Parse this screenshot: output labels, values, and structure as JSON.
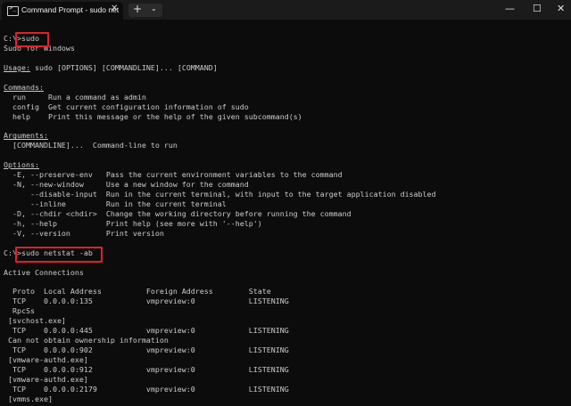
{
  "window": {
    "tab_title": "Command Prompt - sudo  net",
    "tab_icon_glyph": ">_",
    "close_glyph": "✕",
    "new_tab_glyph": "+",
    "dropdown_glyph": "⌄",
    "minimize_glyph": "—",
    "maximize_glyph": "☐",
    "window_close_glyph": "✕"
  },
  "terminal": {
    "lines": [
      "C:\\>sudo",
      "Sudo for Windows",
      "",
      "Usage: sudo [OPTIONS] [COMMANDLINE]... [COMMAND]",
      "",
      "Commands:",
      "  run     Run a command as admin",
      "  config  Get current configuration information of sudo",
      "  help    Print this message or the help of the given subcommand(s)",
      "",
      "Arguments:",
      "  [COMMANDLINE]...  Command-line to run",
      "",
      "Options:",
      "  -E, --preserve-env   Pass the current environment variables to the command",
      "  -N, --new-window     Use a new window for the command",
      "      --disable-input  Run in the current terminal, with input to the target application disabled",
      "      --inline         Run in the current terminal",
      "  -D, --chdir <chdir>  Change the working directory before running the command",
      "  -h, --help           Print help (see more with '--help')",
      "  -V, --version        Print version",
      "",
      "C:\\>sudo netstat -ab",
      "",
      "Active Connections",
      "",
      "  Proto  Local Address          Foreign Address        State",
      "  TCP    0.0.0.0:135            vmpreview:0            LISTENING",
      "  RpcSs",
      " [svchost.exe]",
      "  TCP    0.0.0.0:445            vmpreview:0            LISTENING",
      " Can not obtain ownership information",
      "  TCP    0.0.0.0:902            vmpreview:0            LISTENING",
      " [vmware-authd.exe]",
      "  TCP    0.0.0.0:912            vmpreview:0            LISTENING",
      " [vmware-authd.exe]",
      "  TCP    0.0.0.0:2179           vmpreview:0            LISTENING",
      " [vmms.exe]"
    ]
  }
}
